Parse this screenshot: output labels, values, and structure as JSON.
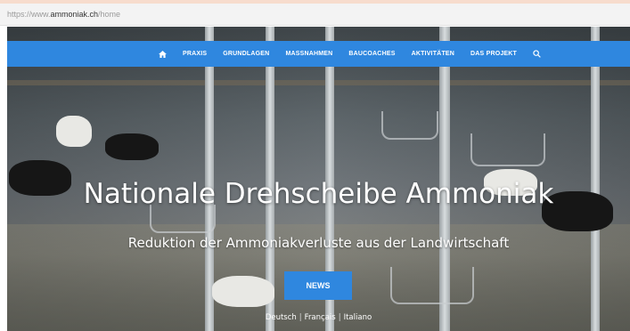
{
  "browser": {
    "url_prefix": "https://www.",
    "url_domain": "ammoniak.ch",
    "url_path": "/home"
  },
  "nav": {
    "home_icon": "home-icon",
    "items": [
      "PRAXIS",
      "GRUNDLAGEN",
      "MASSNAHMEN",
      "BAUCOACHES",
      "AKTIVITÄTEN",
      "DAS PROJEKT"
    ],
    "search_icon": "search-icon",
    "color": "#2f87df"
  },
  "hero": {
    "title": "Nationale Drehscheibe Ammoniak",
    "subtitle": "Reduktion der Ammoniakverluste aus der Landwirtschaft",
    "button": "NEWS",
    "languages": [
      "Deutsch",
      "Français",
      "Italiano"
    ]
  }
}
